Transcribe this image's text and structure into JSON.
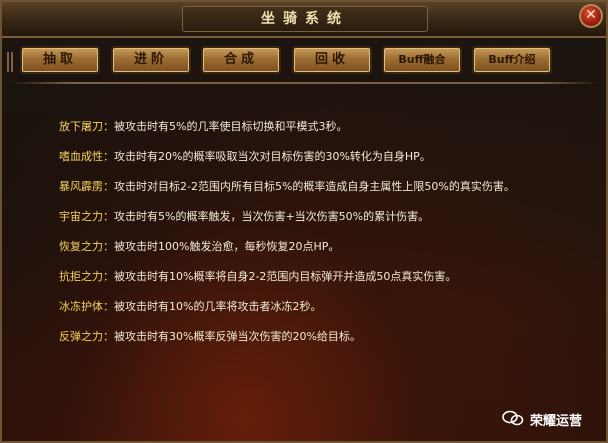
{
  "window": {
    "title": "坐骑系统",
    "close_label": "✕"
  },
  "tabs": [
    {
      "label": "抽取"
    },
    {
      "label": "进阶"
    },
    {
      "label": "合成"
    },
    {
      "label": "回收"
    },
    {
      "label": "Buff融合"
    },
    {
      "label": "Buff介绍"
    }
  ],
  "skills": [
    {
      "name": "放下屠刀：",
      "desc": "被攻击时有5%的几率使目标切换和平模式3秒。"
    },
    {
      "name": "嗜血成性：",
      "desc": "攻击时有20%的概率吸取当次对目标伤害的30%转化为自身HP。"
    },
    {
      "name": "暴风霹雳：",
      "desc": "攻击时对目标2-2范围内所有目标5%的概率造成自身主属性上限50%的真实伤害。"
    },
    {
      "name": "宇宙之力：",
      "desc": "攻击时有5%的概率触发，当次伤害+当次伤害50%的累计伤害。"
    },
    {
      "name": "恢复之力：",
      "desc": "被攻击时100%触发治愈，每秒恢复20点HP。"
    },
    {
      "name": "抗拒之力：",
      "desc": "被攻击时有10%概率将自身2-2范围内目标弹开并造成50点真实伤害。"
    },
    {
      "name": "冰冻护体：",
      "desc": "被攻击时有10%的几率将攻击者冰冻2秒。"
    },
    {
      "name": "反弹之力：",
      "desc": "被攻击时有30%概率反弹当次伤害的20%给目标。"
    }
  ],
  "watermark": {
    "icon": "wechat-icon",
    "text": "荣耀运营"
  },
  "colors": {
    "skill_name": "#f6d35a",
    "skill_desc": "#f2ead4",
    "tab_gold": "#9d6d32"
  }
}
